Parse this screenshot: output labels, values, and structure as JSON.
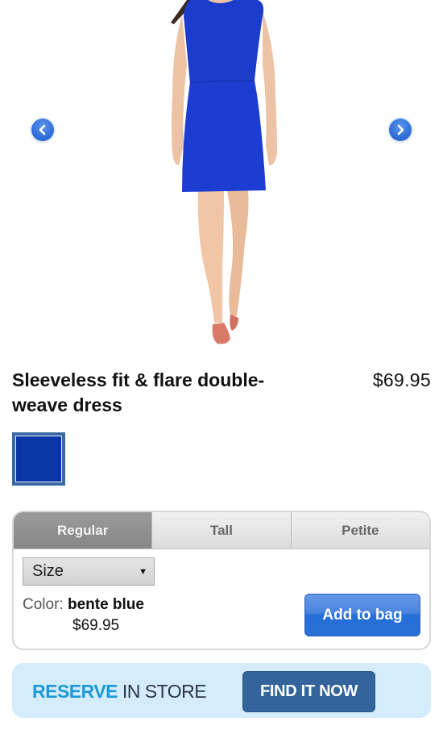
{
  "gallery": {
    "image_alt": "Model wearing sleeveless fit & flare dress in bente blue",
    "prev_icon": "chevron-left-icon",
    "next_icon": "chevron-right-icon"
  },
  "product": {
    "title": "Sleeveless fit & flare double-weave dress",
    "price": "$69.95",
    "swatches": [
      {
        "name": "bente blue",
        "color": "#0b36a8",
        "selected": true
      }
    ]
  },
  "variants": {
    "tabs": [
      {
        "label": "Regular",
        "active": true
      },
      {
        "label": "Tall",
        "active": false
      },
      {
        "label": "Petite",
        "active": false
      }
    ],
    "size_select": {
      "selected": "Size"
    },
    "color_label": "Color:",
    "color_value": "bente blue",
    "price": "$69.95",
    "add_to_bag_label": "Add to bag"
  },
  "reserve": {
    "strong": "RESERVE",
    "light": "IN STORE",
    "button_label": "FIND IT NOW"
  },
  "colors": {
    "dress_blue": "#1e3fd0",
    "add_button": "#2a6fd6",
    "find_button": "#33649b",
    "reserve_bg": "#d4ecfb",
    "reserve_accent": "#1a9ad9"
  }
}
